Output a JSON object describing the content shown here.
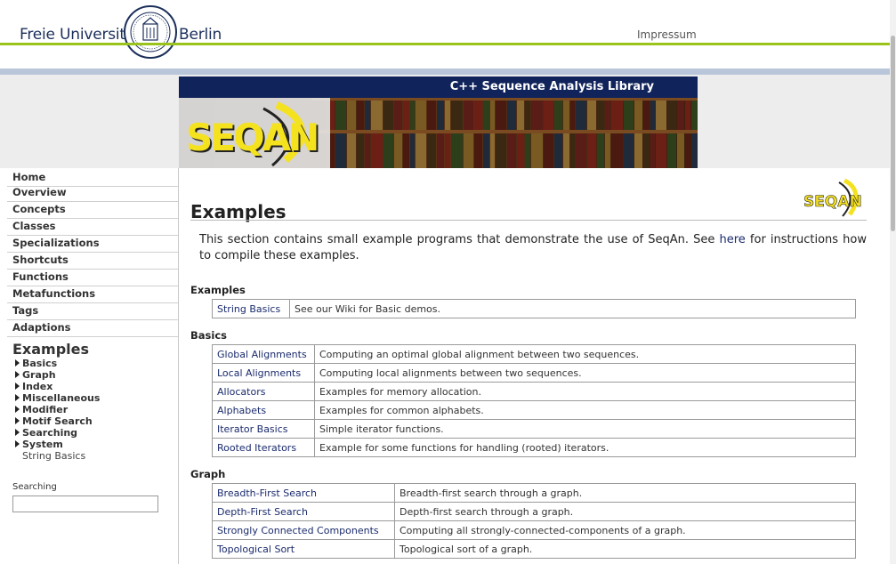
{
  "header": {
    "brand_left": "Freie Universität",
    "brand_right": "Berlin",
    "impressum": "Impressum"
  },
  "banner": {
    "tagline": "C++ Sequence Analysis Library",
    "logo_text": "SEQAN"
  },
  "sidebar": {
    "nav": [
      "Home",
      "Overview",
      "Concepts",
      "Classes",
      "Specializations",
      "Shortcuts",
      "Functions",
      "Metafunctions",
      "Tags",
      "Adaptions"
    ],
    "current_section": "Examples",
    "sub_items": [
      "Basics",
      "Graph",
      "Index",
      "Miscellaneous",
      "Modifier",
      "Motif Search",
      "Searching",
      "System"
    ],
    "sub_leaf": "String Basics",
    "search_label": "Searching",
    "search_value": ""
  },
  "main": {
    "title": "Examples",
    "intro_before_link": "This section contains small example programs that demonstrate the use of SeqAn. See ",
    "intro_link": "here",
    "intro_after_link": " for instructions how to compile these examples.",
    "small_logo_text": "SEQAN",
    "sections": [
      {
        "heading": "Examples",
        "rows": [
          {
            "name": "String Basics",
            "desc": "See our Wiki for Basic demos."
          }
        ]
      },
      {
        "heading": "Basics",
        "rows": [
          {
            "name": "Global Alignments",
            "desc": "Computing an optimal global alignment between two sequences."
          },
          {
            "name": "Local Alignments",
            "desc": "Computing local alignments between two sequences."
          },
          {
            "name": "Allocators",
            "desc": "Examples for memory allocation."
          },
          {
            "name": "Alphabets",
            "desc": "Examples for common alphabets."
          },
          {
            "name": "Iterator Basics",
            "desc": "Simple iterator functions."
          },
          {
            "name": "Rooted Iterators",
            "desc": "Example for some functions for handling (rooted) iterators."
          }
        ]
      },
      {
        "heading": "Graph",
        "rows": [
          {
            "name": "Breadth-First Search",
            "desc": "Breadth-first search through a graph."
          },
          {
            "name": "Depth-First Search",
            "desc": "Depth-first search through a graph."
          },
          {
            "name": "Strongly Connected Components",
            "desc": "Computing all strongly-connected-components of a graph."
          },
          {
            "name": "Topological Sort",
            "desc": "Topological sort of a graph."
          }
        ]
      }
    ]
  },
  "colors": {
    "green_line": "#9ac31c",
    "banner_navy": "#10235a",
    "link_blue": "#1a2b6d",
    "logo_yellow": "#f5e21f"
  }
}
